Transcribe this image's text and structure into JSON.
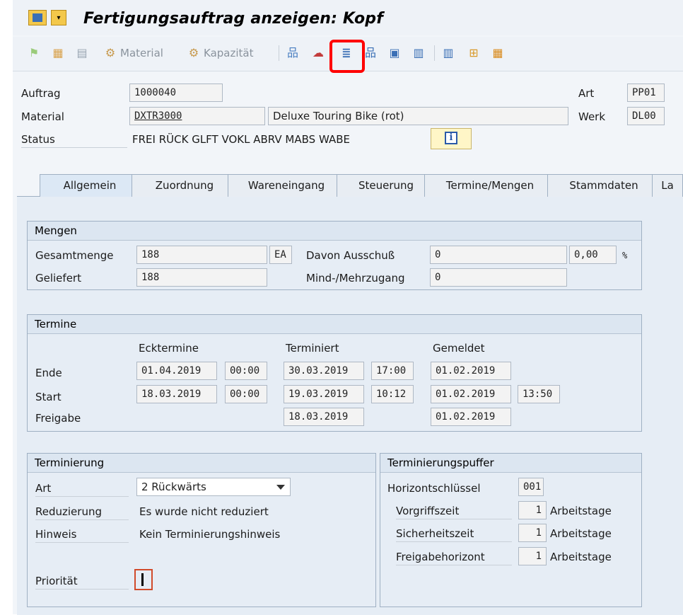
{
  "window": {
    "title": "Fertigungsauftrag anzeigen: Kopf"
  },
  "toolbar": {
    "material_label": "Material",
    "capacity_label": "Kapazität",
    "icons": [
      "flag-icon",
      "component-icon",
      "list-icon",
      "material-icon",
      "capacity-icon",
      "network-icon",
      "cloud-icon",
      "operation-icon",
      "hierarchy-icon",
      "documents-icon",
      "doc-links-icon",
      "columns-icon",
      "tree-icon",
      "grid-icon"
    ]
  },
  "header": {
    "order_label": "Auftrag",
    "order_value": "1000040",
    "type_label": "Art",
    "type_value": "PP01",
    "material_label": "Material",
    "material_value": "DXTR3000",
    "material_desc": "Deluxe Touring Bike (rot)",
    "plant_label": "Werk",
    "plant_value": "DL00",
    "status_label": "Status",
    "status_value": "FREI RÜCK GLFT VOKL ABRV MABS WABE"
  },
  "tabs": [
    "Allgemein",
    "Zuordnung",
    "Wareneingang",
    "Steuerung",
    "Termine/Mengen",
    "Stammdaten",
    "La"
  ],
  "quantities": {
    "title": "Mengen",
    "total_label": "Gesamtmenge",
    "total_value": "188",
    "unit": "EA",
    "scrap_label": "Davon Ausschuß",
    "scrap_value": "0",
    "scrap_pct": "0,00",
    "pct_sign": "%",
    "delivered_label": "Geliefert",
    "delivered_value": "188",
    "over_under_label": "Mind-/Mehrzugang",
    "over_under_value": "0"
  },
  "dates": {
    "title": "Termine",
    "col_basic": "Ecktermine",
    "col_scheduled": "Terminiert",
    "col_confirmed": "Gemeldet",
    "end_label": "Ende",
    "start_label": "Start",
    "release_label": "Freigabe",
    "end_basic_date": "01.04.2019",
    "end_basic_time": "00:00",
    "end_sched_date": "30.03.2019",
    "end_sched_time": "17:00",
    "end_conf_date": "01.02.2019",
    "start_basic_date": "18.03.2019",
    "start_basic_time": "00:00",
    "start_sched_date": "19.03.2019",
    "start_sched_time": "10:12",
    "start_conf_date": "01.02.2019",
    "start_conf_time": "13:50",
    "release_sched_date": "18.03.2019",
    "release_conf_date": "01.02.2019"
  },
  "scheduling": {
    "title": "Terminierung",
    "type_label": "Art",
    "type_value": "2 Rückwärts",
    "reduction_label": "Reduzierung",
    "reduction_value": "Es wurde nicht reduziert",
    "note_label": "Hinweis",
    "note_value": "Kein Terminierungshinweis",
    "priority_label": "Priorität"
  },
  "float": {
    "title": "Terminierungspuffer",
    "horizon_label": "Horizontschlüssel",
    "horizon_value": "001",
    "pre_label": "Vorgriffszeit",
    "pre_value": "1",
    "safety_label": "Sicherheitszeit",
    "safety_value": "1",
    "release_label": "Freigabehorizont",
    "release_value": "1",
    "unit": "Arbeitstage"
  }
}
